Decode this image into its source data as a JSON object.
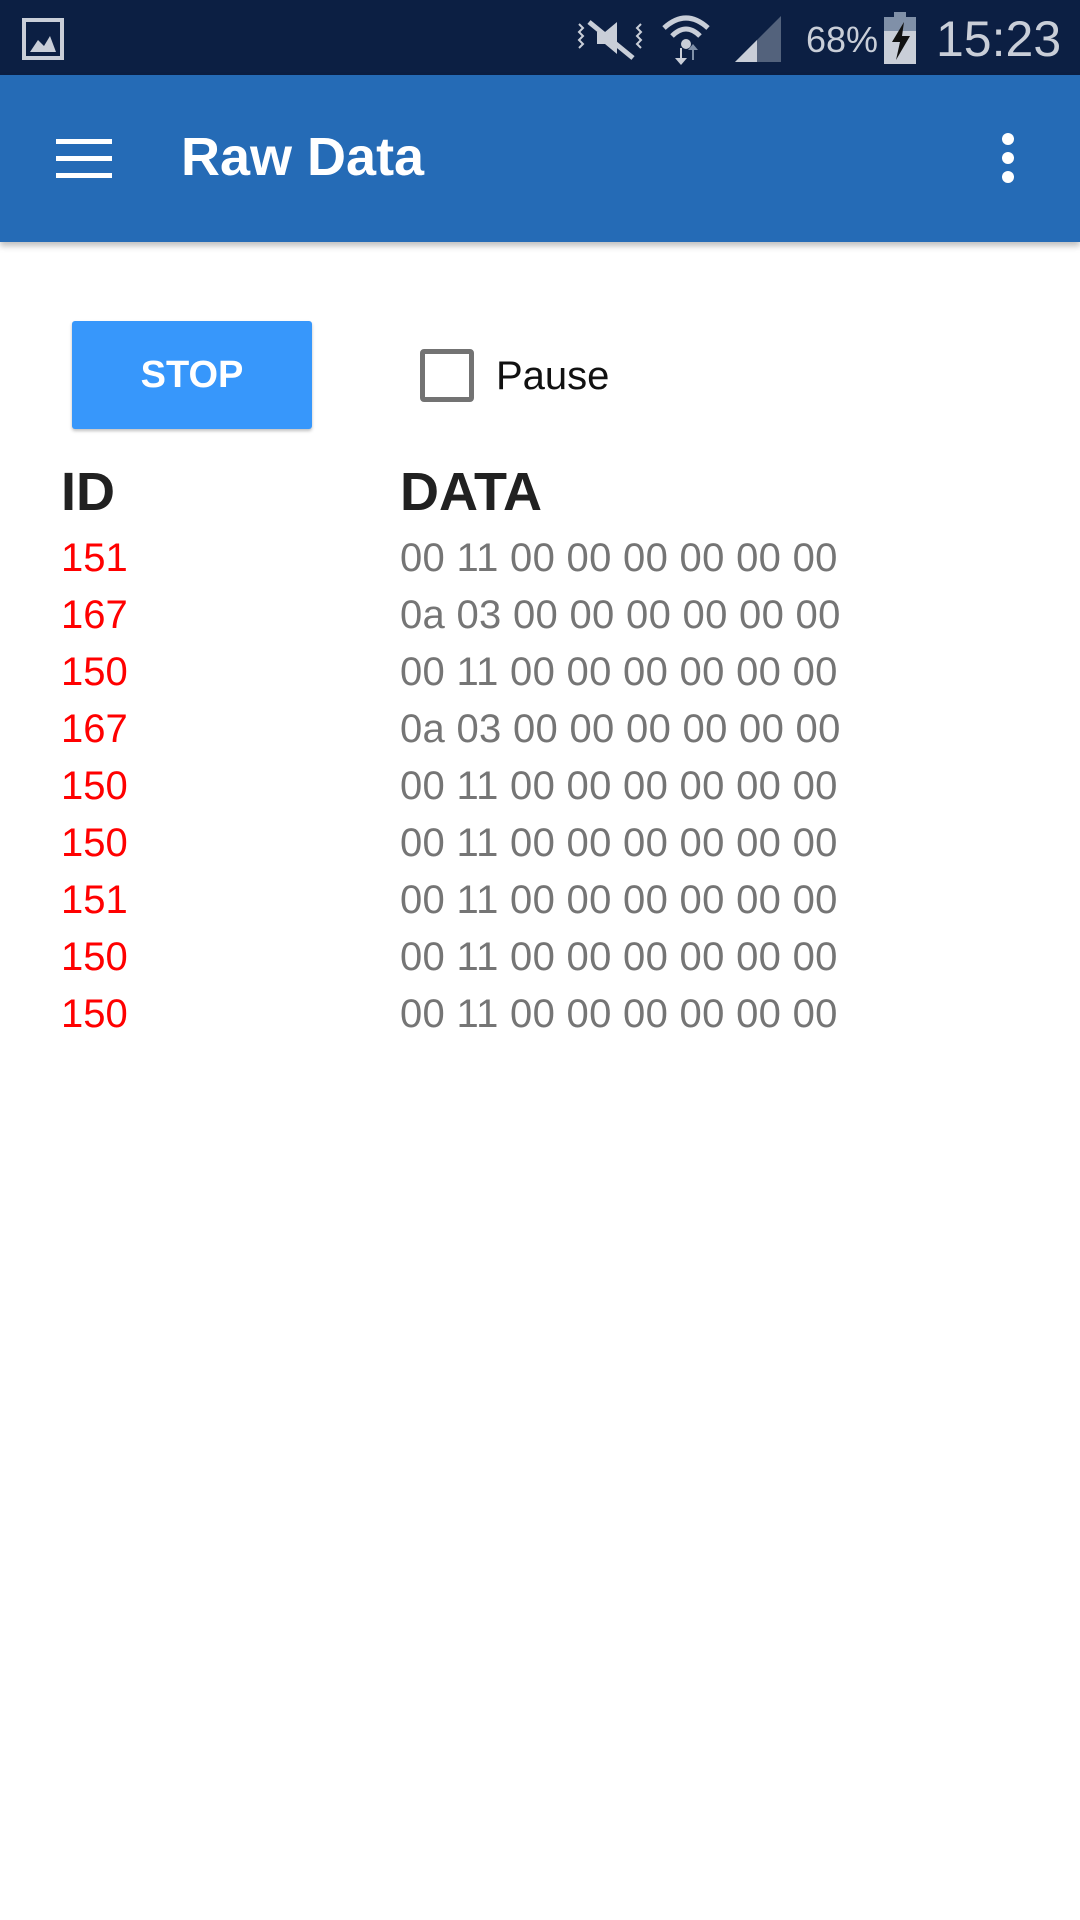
{
  "status_bar": {
    "battery": "68%",
    "time": "15:23",
    "icons": [
      "gallery-icon",
      "vibrate-mute-icon",
      "wifi-icon",
      "signal-icon",
      "battery-charging-icon"
    ]
  },
  "app_bar": {
    "title": "Raw Data",
    "menu_icon": "hamburger-icon",
    "overflow_icon": "more-vert-icon"
  },
  "controls": {
    "stop_label": "STOP",
    "pause_label": "Pause",
    "pause_checked": false
  },
  "table": {
    "headers": [
      "ID",
      "DATA"
    ],
    "rows": [
      {
        "id": "151",
        "data": "00 11 00 00 00 00 00 00"
      },
      {
        "id": "167",
        "data": "0a 03 00 00 00 00 00 00"
      },
      {
        "id": "150",
        "data": "00 11 00 00 00 00 00 00"
      },
      {
        "id": "167",
        "data": "0a 03 00 00 00 00 00 00"
      },
      {
        "id": "150",
        "data": "00 11 00 00 00 00 00 00"
      },
      {
        "id": "150",
        "data": "00 11 00 00 00 00 00 00"
      },
      {
        "id": "151",
        "data": "00 11 00 00 00 00 00 00"
      },
      {
        "id": "150",
        "data": "00 11 00 00 00 00 00 00"
      },
      {
        "id": "150",
        "data": "00 11 00 00 00 00 00 00"
      }
    ]
  },
  "colors": {
    "status_bar": "#0c1f43",
    "app_bar": "#256bb6",
    "button": "#3797fb",
    "id_text": "#ff0000",
    "data_text": "#757575"
  }
}
